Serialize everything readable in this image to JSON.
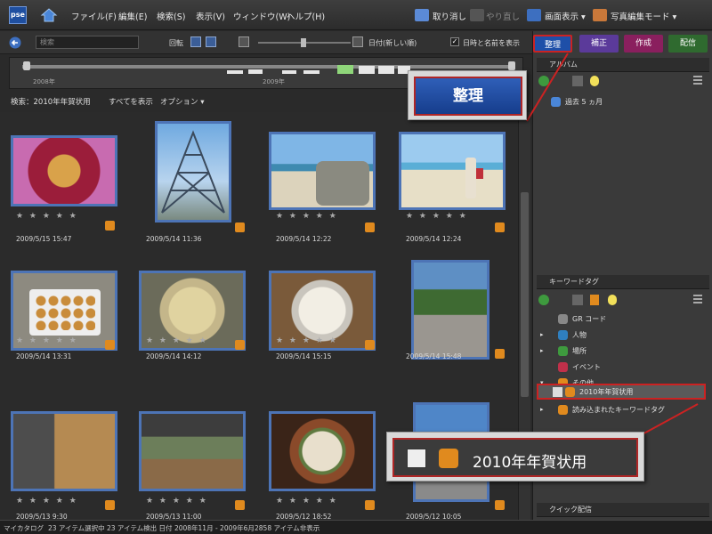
{
  "app": {
    "logo_text": "pse"
  },
  "menu": {
    "items": [
      "ファイル(F)",
      "編集(E)",
      "検索(S)",
      "表示(V)",
      "ウィンドウ(W)",
      "ヘルプ(H)"
    ],
    "undo_label": "取り消し",
    "redo_label": "やり直し",
    "display_label": "画面表示 ▾",
    "photo_edit_label": "写真編集モード ▾"
  },
  "toolbar": {
    "search_placeholder": "検索",
    "rotate_label": "回転",
    "date_sort_label": "日付(新しい順)",
    "show_date_filename_label": "日時と名前を表示"
  },
  "timeline": {
    "year_left": "2008年",
    "year_right": "2009年"
  },
  "filter": {
    "search_text": "検索：2010年年賀状用",
    "show_all_label": "すべてを表示",
    "options_label": "オプション ▾"
  },
  "photos": [
    {
      "date": "2009/5/15 15:47",
      "rating": "★ ★ ★ ★ ★",
      "subject": "mango"
    },
    {
      "date": "2009/5/14 11:36",
      "rating": "★ ★ ★ ★ ★",
      "subject": "bridge"
    },
    {
      "date": "2009/5/14 12:22",
      "rating": "★ ★ ★ ★ ★",
      "subject": "beach-rocks"
    },
    {
      "date": "2009/5/14 12:24",
      "rating": "★ ★ ★ ★ ★",
      "subject": "beach-person"
    },
    {
      "date": "2009/5/14 13:31",
      "rating": "★ ★ ★ ★ ★",
      "subject": "sweets-box"
    },
    {
      "date": "2009/5/14 14:12",
      "rating": "★ ★ ★ ★ ★",
      "subject": "noodles"
    },
    {
      "date": "2009/5/14 15:15",
      "rating": "★ ★ ★ ★ ★",
      "subject": "dessert"
    },
    {
      "date": "2009/5/14 15:48",
      "rating": "★ ★ ★ ★ ★",
      "subject": "coast-flowers"
    },
    {
      "date": "2009/5/13 9:30",
      "rating": "★ ★ ★ ★ ★",
      "subject": "dog"
    },
    {
      "date": "2009/5/13 11:00",
      "rating": "★ ★ ★ ★ ★",
      "subject": "dog-window"
    },
    {
      "date": "2009/5/12 18:52",
      "rating": "★ ★ ★ ★ ★",
      "subject": "ramen"
    },
    {
      "date": "2009/5/12 10:05",
      "rating": "★ ★ ★ ★ ★",
      "subject": "sky-building"
    }
  ],
  "status": {
    "catalog": "マイカタログ",
    "selected": "23 アイテム選択中",
    "found": "23 アイテム検出 日付 2008年11月 - 2009年6月",
    "hidden": "2858 アイテム非表示"
  },
  "panel": {
    "tabs": [
      "整理",
      "補正",
      "作成",
      "配信"
    ],
    "tab_colors": [
      "#1e4fa8",
      "#5b3a9a",
      "#8a1f5e",
      "#2f6a2f"
    ],
    "albums_header": "アルバム",
    "album_item": "過去 5 ヵ月",
    "keywords_header": "キーワードタグ",
    "keywords": [
      {
        "label": "GR コード",
        "color": "#888888"
      },
      {
        "label": "人物",
        "color": "#2f7fbf"
      },
      {
        "label": "場所",
        "color": "#3e9a3e"
      },
      {
        "label": "イベント",
        "color": "#c0304a"
      },
      {
        "label": "その他",
        "color": "#e08a1e"
      },
      {
        "label": "2010年年賀状用",
        "color": "#e08a1e"
      },
      {
        "label": "読み込まれたキーワードタグ",
        "color": "#e08a1e"
      }
    ],
    "quick_share_header": "クイック配信"
  },
  "callouts": {
    "organize_label": "整理",
    "keyword_label": "2010年年賀状用"
  }
}
